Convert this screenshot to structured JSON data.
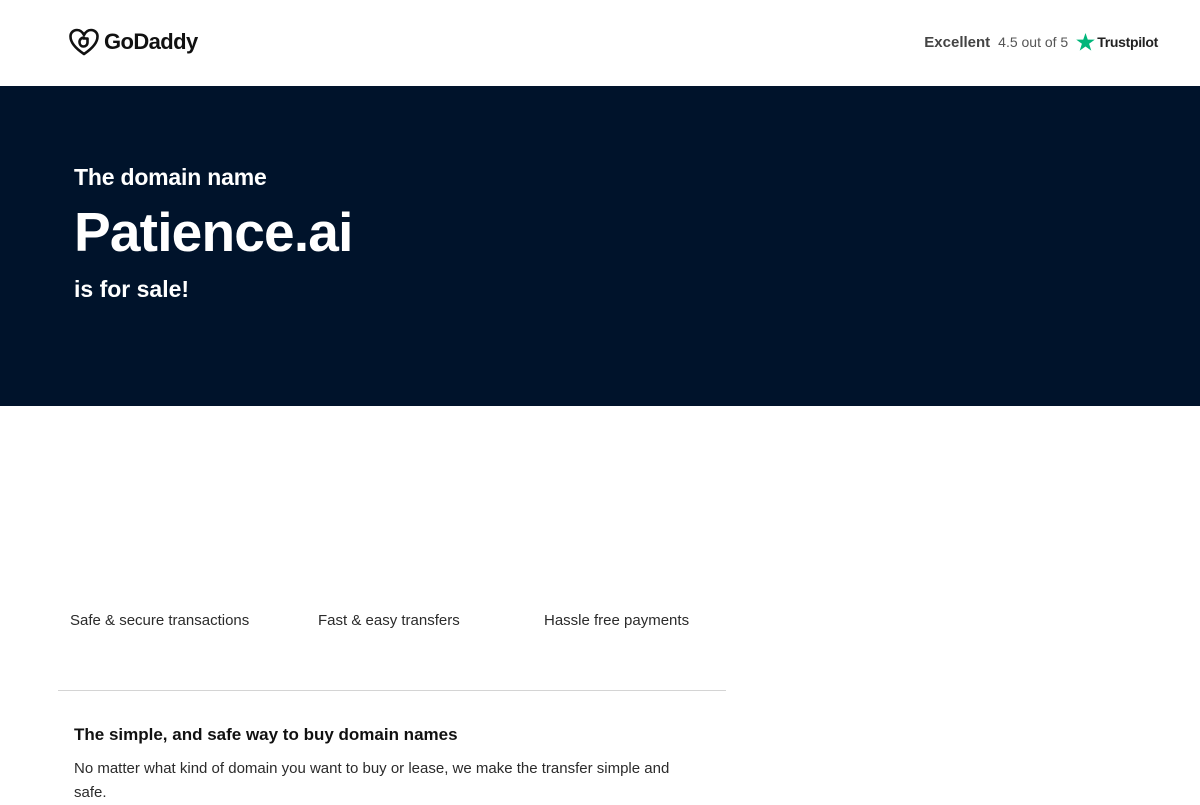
{
  "header": {
    "brand": "GoDaddy",
    "trustpilot": {
      "label": "Excellent",
      "score": "4.5 out of 5",
      "brand": "Trustpilot",
      "star_color": "#00b67a"
    }
  },
  "hero": {
    "pre": "The domain name",
    "domain": "Patience.ai",
    "post": "is for sale!",
    "background": "#00132b"
  },
  "features": [
    {
      "label": "Safe & secure transactions"
    },
    {
      "label": "Fast & easy transfers"
    },
    {
      "label": "Hassle free payments"
    }
  ],
  "info": {
    "title": "The simple, and safe way to buy domain names",
    "body": "No matter what kind of domain you want to buy or lease, we make the transfer simple and safe."
  }
}
